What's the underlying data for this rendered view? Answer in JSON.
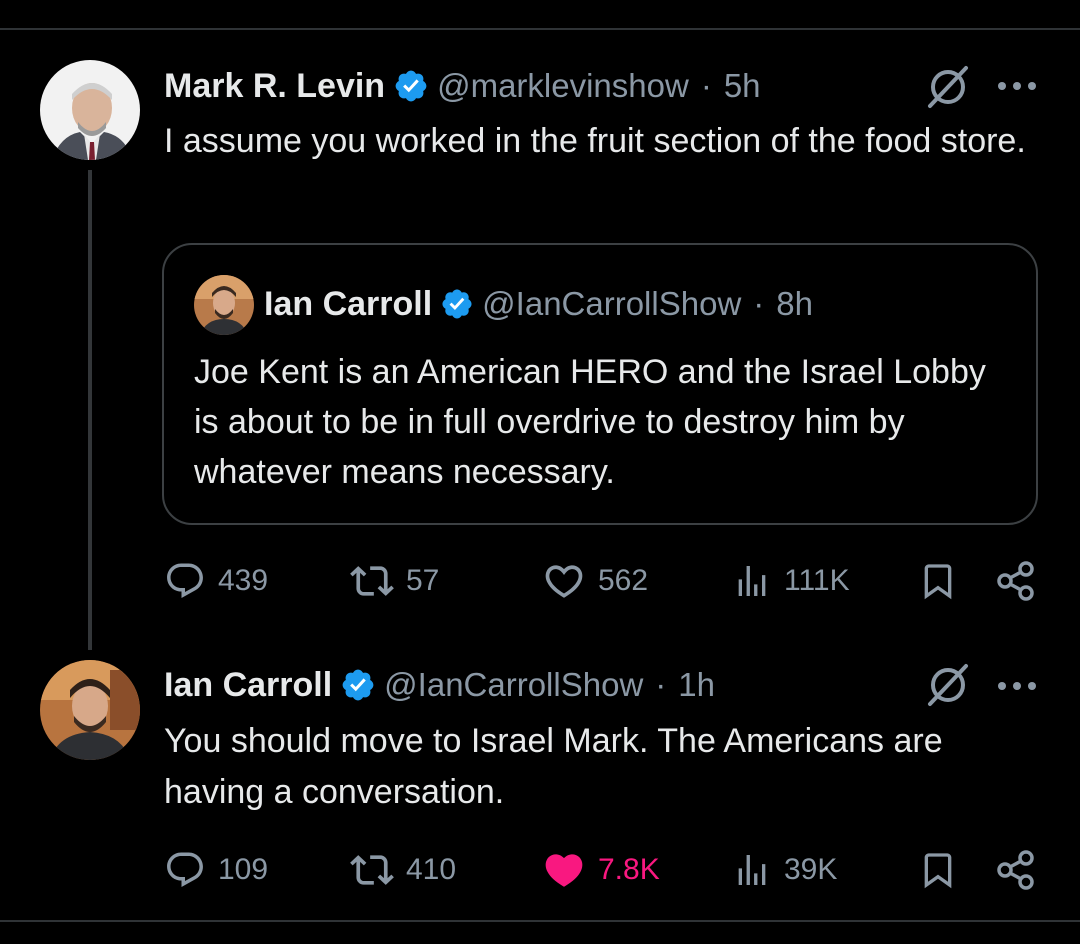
{
  "colors": {
    "background": "#000000",
    "text": "#e7e9ea",
    "muted": "#8b98a5",
    "verified_blue": "#1d9bf0",
    "like_pink": "#f91880",
    "border": "#2f3336"
  },
  "icons": [
    "verified-badge-icon",
    "grok-icon",
    "more-icon",
    "reply-icon",
    "retweet-icon",
    "like-icon",
    "views-icon",
    "bookmark-icon",
    "share-icon"
  ],
  "tweets": [
    {
      "name": "Mark R. Levin",
      "handle": "@marklevinshow",
      "separator": "·",
      "time": "5h",
      "text": "I assume you worked in the fruit section of the food store.",
      "quote": {
        "name": "Ian Carroll",
        "handle": "@IanCarrollShow",
        "separator": "·",
        "time": "8h",
        "text": "Joe Kent is an American HERO and the Israel Lobby is about to be in full overdrive to destroy him by whatever means necessary."
      },
      "stats": {
        "replies": "439",
        "reposts": "57",
        "likes": "562",
        "views": "111K",
        "liked": false
      }
    },
    {
      "name": "Ian Carroll",
      "handle": "@IanCarrollShow",
      "separator": "·",
      "time": "1h",
      "text": "You should move to Israel Mark. The Americans are having a conversation.",
      "stats": {
        "replies": "109",
        "reposts": "410",
        "likes": "7.8K",
        "views": "39K",
        "liked": true
      }
    }
  ]
}
